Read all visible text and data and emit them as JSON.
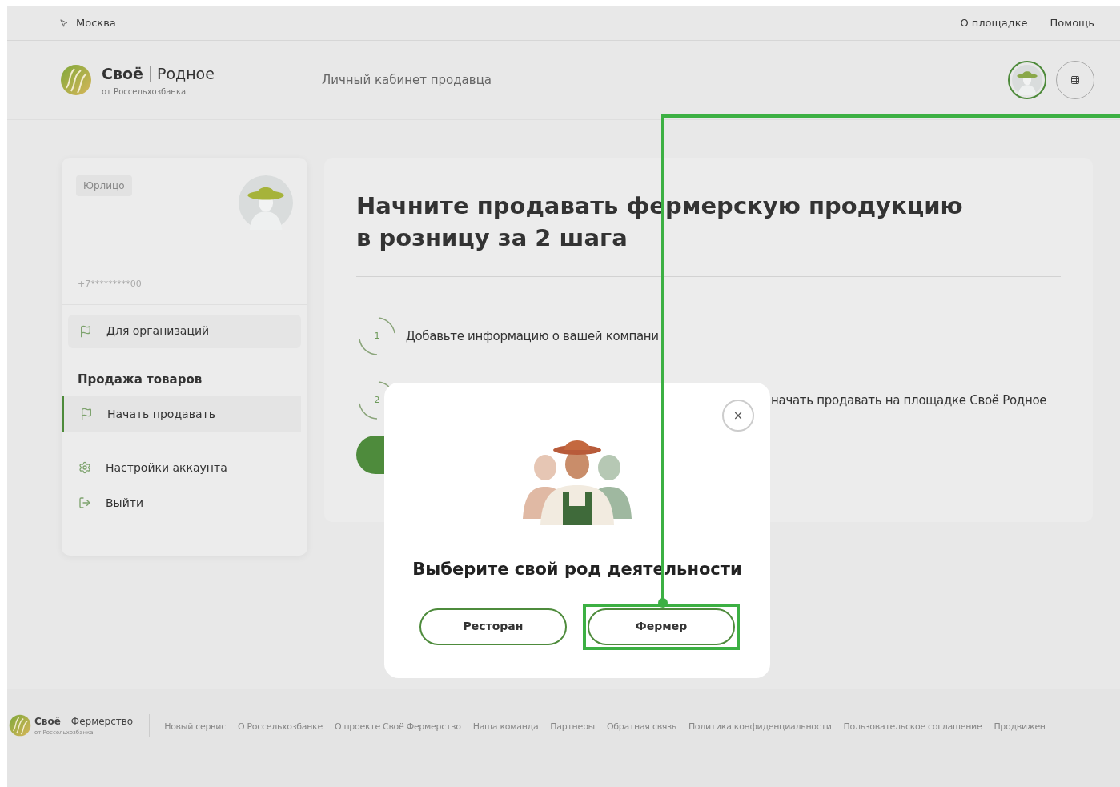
{
  "top_bar": {
    "city": "Москва",
    "links": [
      "О площадке",
      "Помощь"
    ]
  },
  "header": {
    "logo": {
      "brand_bold": "Своё",
      "brand": "Родное",
      "subtitle": "от Россельхозбанка"
    },
    "section_title": "Личный кабинет продавца"
  },
  "sidebar": {
    "badge": "Юрлицо",
    "phone": "+7*********00",
    "org_item": "Для организаций",
    "section_title": "Продажа товаров",
    "items": [
      {
        "label": "Начать продавать",
        "selected": true
      }
    ],
    "account_items": [
      {
        "label": "Настройки аккаунта",
        "kind": "gear"
      },
      {
        "label": "Выйти",
        "kind": "exit"
      }
    ]
  },
  "main": {
    "title_lines": [
      "Начните продавать фермерскую продукцию",
      "в розницу за 2 шага"
    ],
    "steps": [
      {
        "number": "1",
        "text": "Добавьте информацию о вашей компани"
      },
      {
        "number": "2",
        "text": "начать продавать на площадке Своё Родное"
      }
    ]
  },
  "modal": {
    "close": "×",
    "title": "Выберите свой род деятельности",
    "buttons": [
      {
        "label": "Ресторан",
        "highlighted": false
      },
      {
        "label": "Фермер",
        "highlighted": true
      }
    ]
  },
  "footer": {
    "logo": {
      "brand_bold": "Своё",
      "brand": "Фермерство",
      "subtitle": "от Россельхозбанка"
    },
    "links": [
      "Новый сервис",
      "О Россельхозбанке",
      "О проекте Своё Фермерство",
      "Наша команда",
      "Партнеры",
      "Обратная связь",
      "Политика конфиденциальности",
      "Пользовательское соглашение",
      "Продвижен"
    ]
  }
}
